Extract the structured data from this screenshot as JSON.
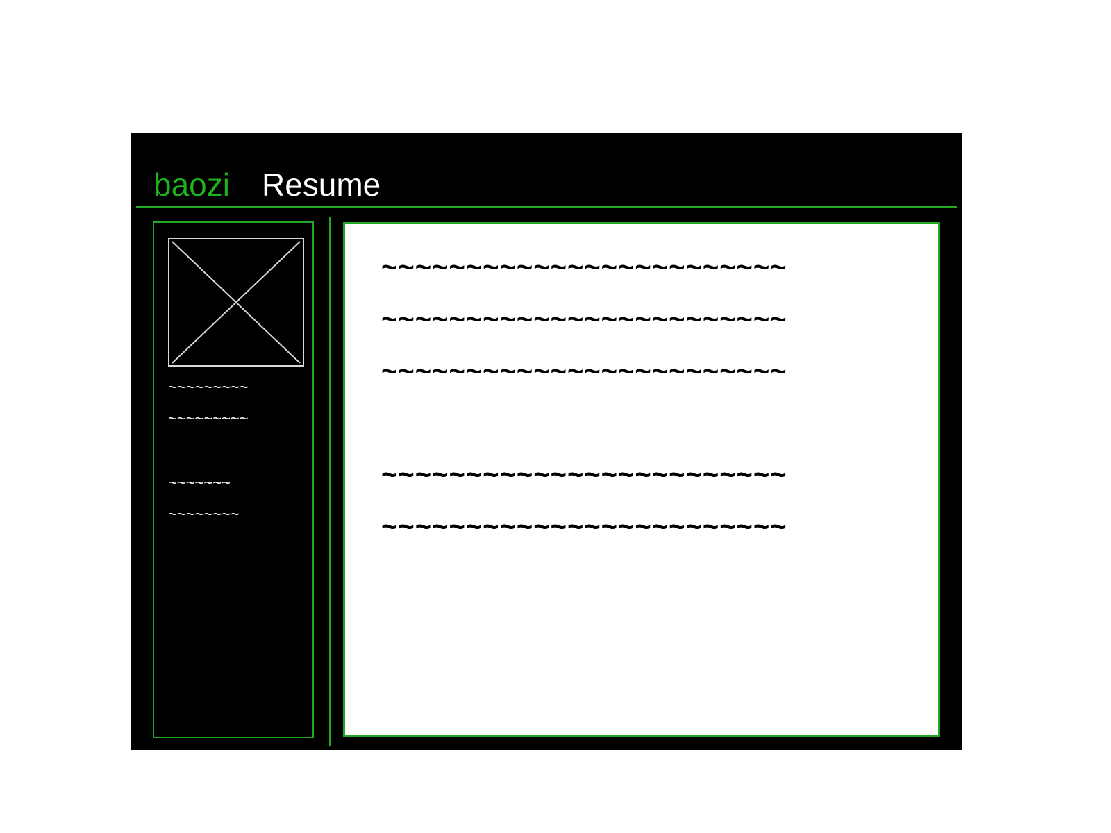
{
  "header": {
    "brand": "baozi",
    "title": "Resume"
  },
  "sidebar": {
    "avatar_icon": "image-placeholder-icon",
    "lines": [
      "~~~~~~~~~",
      "~~~~~~~~~",
      "~~~~~~~",
      "~~~~~~~~"
    ]
  },
  "main": {
    "lines": [
      "~~~~~~~~~~~~~~~~~~~~~~~~",
      "~~~~~~~~~~~~~~~~~~~~~~~~",
      "~~~~~~~~~~~~~~~~~~~~~~~~",
      "~~~~~~~~~~~~~~~~~~~~~~~~",
      "~~~~~~~~~~~~~~~~~~~~~~~~"
    ]
  },
  "colors": {
    "accent": "#1db31d",
    "frame_background": "#000000",
    "content_background": "#ffffff"
  }
}
